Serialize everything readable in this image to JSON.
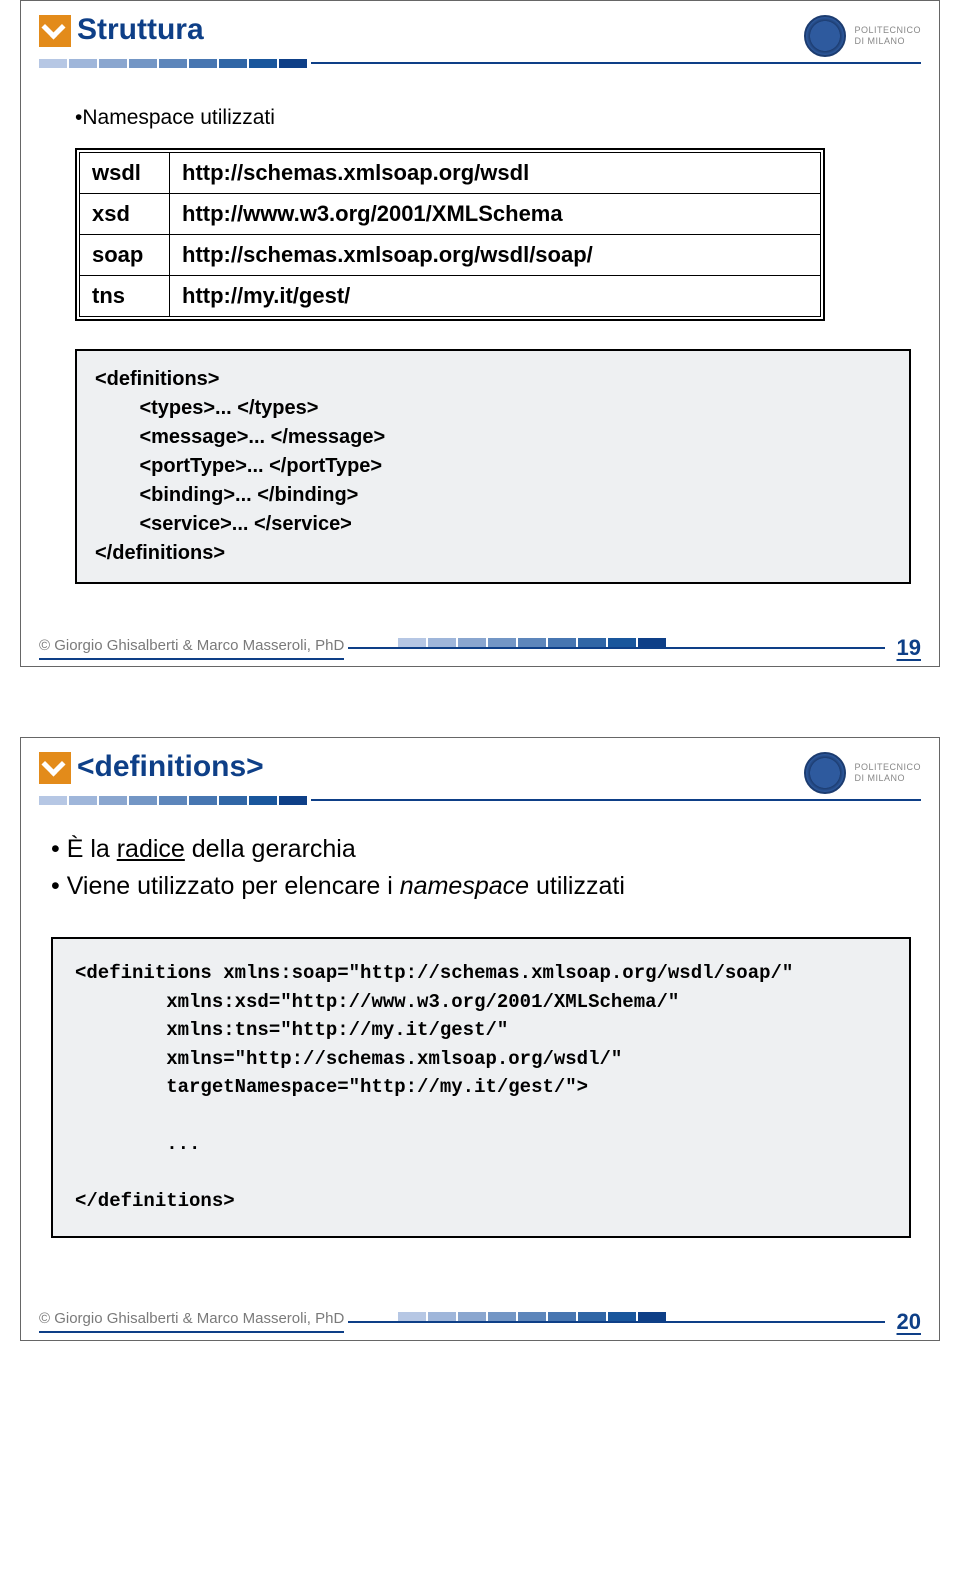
{
  "slides": [
    {
      "title": "Struttura",
      "logo_text": "POLITECNICO\nDI MILANO",
      "intro": "•Namespace utilizzati",
      "ns_rows": [
        {
          "prefix": "wsdl",
          "uri": "http://schemas.xmlsoap.org/wsdl"
        },
        {
          "prefix": "xsd",
          "uri": "http://www.w3.org/2001/XMLSchema"
        },
        {
          "prefix": "soap",
          "uri": "http://schemas.xmlsoap.org/wsdl/soap/"
        },
        {
          "prefix": "tns",
          "uri": "http://my.it/gest/"
        }
      ],
      "code": "<definitions>\n        <types>... </types>\n        <message>... </message>\n        <portType>... </portType>\n        <binding>... </binding>\n        <service>... </service>\n</definitions>",
      "footer_copy": "© Giorgio Ghisalberti & Marco Masseroli, PhD",
      "page_num": "19"
    },
    {
      "title": "<definitions>",
      "logo_text": "POLITECNICO\nDI MILANO",
      "bullets": [
        {
          "pre": "• È la ",
          "under": "radice",
          "post": " della gerarchia"
        },
        {
          "pre": "• Viene utilizzato per elencare i ",
          "ital": "namespace",
          "post": " utilizzati"
        }
      ],
      "code2": "<definitions xmlns:soap=\"http://schemas.xmlsoap.org/wsdl/soap/\"\n        xmlns:xsd=\"http://www.w3.org/2001/XMLSchema/\"\n        xmlns:tns=\"http://my.it/gest/\"\n        xmlns=\"http://schemas.xmlsoap.org/wsdl/\"\n        targetNamespace=\"http://my.it/gest/\">\n\n        ...\n\n</definitions>",
      "footer_copy": "© Giorgio Ghisalberti & Marco Masseroli, PhD",
      "page_num": "20"
    }
  ],
  "colors": {
    "accent_segments": [
      "#b6c7e4",
      "#9fb6da",
      "#8aa6cf",
      "#7396c5",
      "#5d86bb",
      "#4776b1",
      "#3066a6",
      "#19569c",
      "#0e3f87"
    ]
  }
}
